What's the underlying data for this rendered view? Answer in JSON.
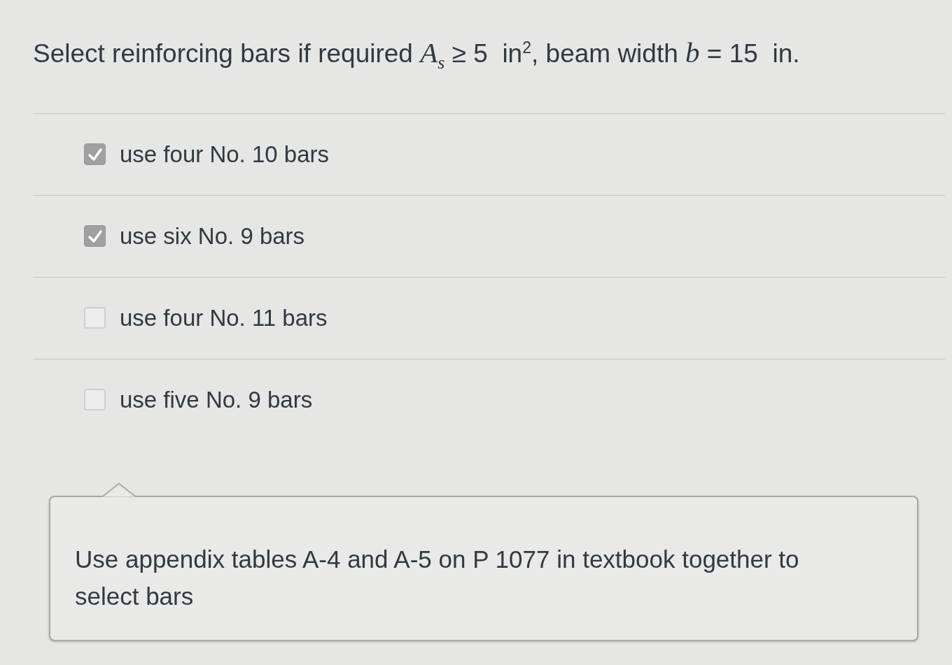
{
  "question": "Select reinforcing bars if required *A*$_{s}$ ≥ 5  in$^{2}$, beam width *b* = 15  in.",
  "answers": [
    {
      "label": "use four No. 10 bars",
      "checked": true
    },
    {
      "label": "use six No. 9 bars",
      "checked": true
    },
    {
      "label": "use four No. 11 bars",
      "checked": false
    },
    {
      "label": "use five No. 9 bars",
      "checked": false
    }
  ],
  "comment": {
    "text": "Use appendix tables A-4 and A-5 on P 1077 in textbook together to select bars"
  }
}
